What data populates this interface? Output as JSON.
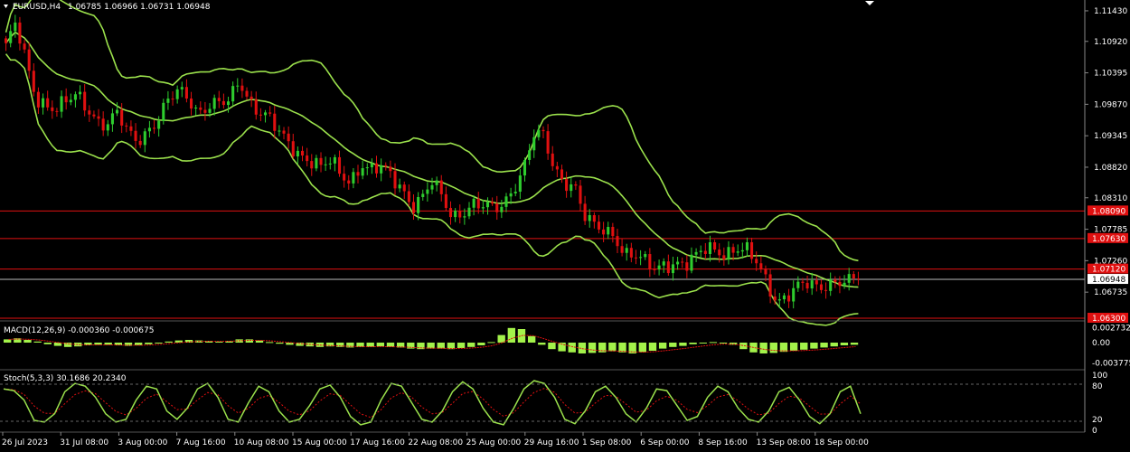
{
  "header": {
    "symbol_label": "EURUSD,H4",
    "ohlc": "1.06785 1.06966 1.06731 1.06948"
  },
  "colors": {
    "background": "#000000",
    "bull": "#2ECC2E",
    "bear": "#E01010",
    "band": "#9BE14C",
    "level_line": "#E01010",
    "macd_hist": "#A3F24A",
    "signal": "#E01010",
    "stoch_main": "#9BE14C",
    "stoch_signal": "#E01010",
    "axis_text": "#FFFFFF"
  },
  "chart_data": [
    {
      "type": "candlestick",
      "name": "EURUSD,H4",
      "ylim": [
        1.063,
        1.1155
      ],
      "yticks": [
        "1.11430",
        "1.10920",
        "1.10395",
        "1.09870",
        "1.09345",
        "1.08820",
        "1.08310",
        "1.07785",
        "1.07260",
        "1.06735"
      ],
      "current_price": "1.06948",
      "horizontal_levels": [
        "1.08090",
        "1.07630",
        "1.07120",
        "1.06300"
      ],
      "xticks": [
        "26 Jul 2023",
        "31 Jul 08:00",
        "3 Aug 00:00",
        "7 Aug 16:00",
        "10 Aug 08:00",
        "15 Aug 00:00",
        "17 Aug 16:00",
        "22 Aug 08:00",
        "25 Aug 00:00",
        "29 Aug 16:00",
        "1 Sep 08:00",
        "6 Sep 00:00",
        "8 Sep 16:00",
        "13 Sep 08:00",
        "18 Sep 00:00"
      ],
      "close_path": [
        1.108,
        1.112,
        1.106,
        1.1,
        1.0985,
        1.0975,
        1.099,
        1.1005,
        1.0985,
        1.096,
        1.095,
        1.097,
        1.094,
        1.093,
        1.0945,
        1.096,
        1.099,
        1.101,
        1.1,
        1.0975,
        1.0985,
        1.0985,
        1.099,
        1.103,
        1.0995,
        1.0975,
        1.096,
        1.0935,
        1.092,
        1.0905,
        1.0895,
        1.088,
        1.089,
        1.087,
        1.086,
        1.089,
        1.0875,
        1.088,
        1.0865,
        1.085,
        1.082,
        1.083,
        1.0855,
        1.083,
        1.08,
        1.081,
        1.082,
        1.0815,
        1.081,
        1.082,
        1.085,
        1.088,
        1.0935,
        1.093,
        1.088,
        1.086,
        1.0855,
        1.08,
        1.078,
        1.0775,
        1.077,
        1.074,
        1.0735,
        1.072,
        1.071,
        1.0722,
        1.0725,
        1.072,
        1.073,
        1.0745,
        1.0745,
        1.074,
        1.0748,
        1.074,
        1.072,
        1.069,
        1.066,
        1.067,
        1.068,
        1.0685,
        1.068,
        1.069,
        1.0695,
        1.069,
        1.0695
      ],
      "bollinger": {
        "upper": "upper band",
        "middle": "middle band",
        "lower": "lower band"
      }
    },
    {
      "type": "bar",
      "name": "MACD(12,26,9)",
      "label": "MACD(12,26,9) -0.000360 -0.000675",
      "yticks": [
        "0.002732",
        "0.00",
        "-0.003775"
      ],
      "ylim": [
        -0.0045,
        0.0035
      ],
      "values": [
        0.0006,
        0.0008,
        0.0005,
        0.0002,
        -0.0003,
        -0.0006,
        -0.0008,
        -0.0007,
        -0.0005,
        -0.0004,
        -0.0004,
        -0.0005,
        -0.0006,
        -0.0005,
        -0.0003,
        -0.0001,
        0.0002,
        0.0004,
        0.0005,
        0.0004,
        0.0003,
        0.0002,
        0.0003,
        0.0006,
        0.0006,
        0.0004,
        0.0001,
        -0.0002,
        -0.0004,
        -0.0006,
        -0.0007,
        -0.0008,
        -0.0007,
        -0.0008,
        -0.0009,
        -0.0008,
        -0.0008,
        -0.0007,
        -0.0008,
        -0.0009,
        -0.0011,
        -0.0012,
        -0.0011,
        -0.0011,
        -0.0012,
        -0.001,
        -0.0008,
        -0.0005,
        0.0001,
        0.0014,
        0.0027,
        0.0025,
        0.0012,
        -0.0004,
        -0.0012,
        -0.0016,
        -0.0018,
        -0.002,
        -0.0019,
        -0.0018,
        -0.0016,
        -0.0018,
        -0.002,
        -0.0018,
        -0.0015,
        -0.0011,
        -0.0008,
        -0.0006,
        -0.0003,
        0.0,
        0.0001,
        0.0,
        -0.0004,
        -0.0012,
        -0.0018,
        -0.002,
        -0.0019,
        -0.0017,
        -0.0015,
        -0.0013,
        -0.0011,
        -0.0009,
        -0.0007,
        -0.0005,
        -0.0004
      ]
    },
    {
      "type": "line",
      "name": "Stoch(5,3,3)",
      "label": "Stoch(5,3,3) 30.1686 20.2340",
      "yticks": [
        "100",
        "80",
        "20",
        "0"
      ],
      "levels": [
        80,
        20
      ],
      "ylim": [
        0,
        100
      ],
      "values": [
        75,
        72,
        55,
        18,
        15,
        30,
        70,
        85,
        80,
        60,
        30,
        15,
        20,
        55,
        80,
        75,
        35,
        20,
        40,
        75,
        85,
        60,
        20,
        15,
        50,
        80,
        70,
        35,
        15,
        20,
        45,
        75,
        82,
        60,
        25,
        10,
        15,
        55,
        85,
        80,
        50,
        20,
        15,
        35,
        70,
        88,
        75,
        40,
        15,
        10,
        40,
        75,
        90,
        85,
        60,
        20,
        12,
        35,
        70,
        80,
        60,
        30,
        15,
        40,
        75,
        72,
        45,
        18,
        25,
        60,
        80,
        70,
        40,
        20,
        15,
        35,
        70,
        78,
        55,
        25,
        12,
        30,
        70,
        80,
        30
      ]
    }
  ]
}
